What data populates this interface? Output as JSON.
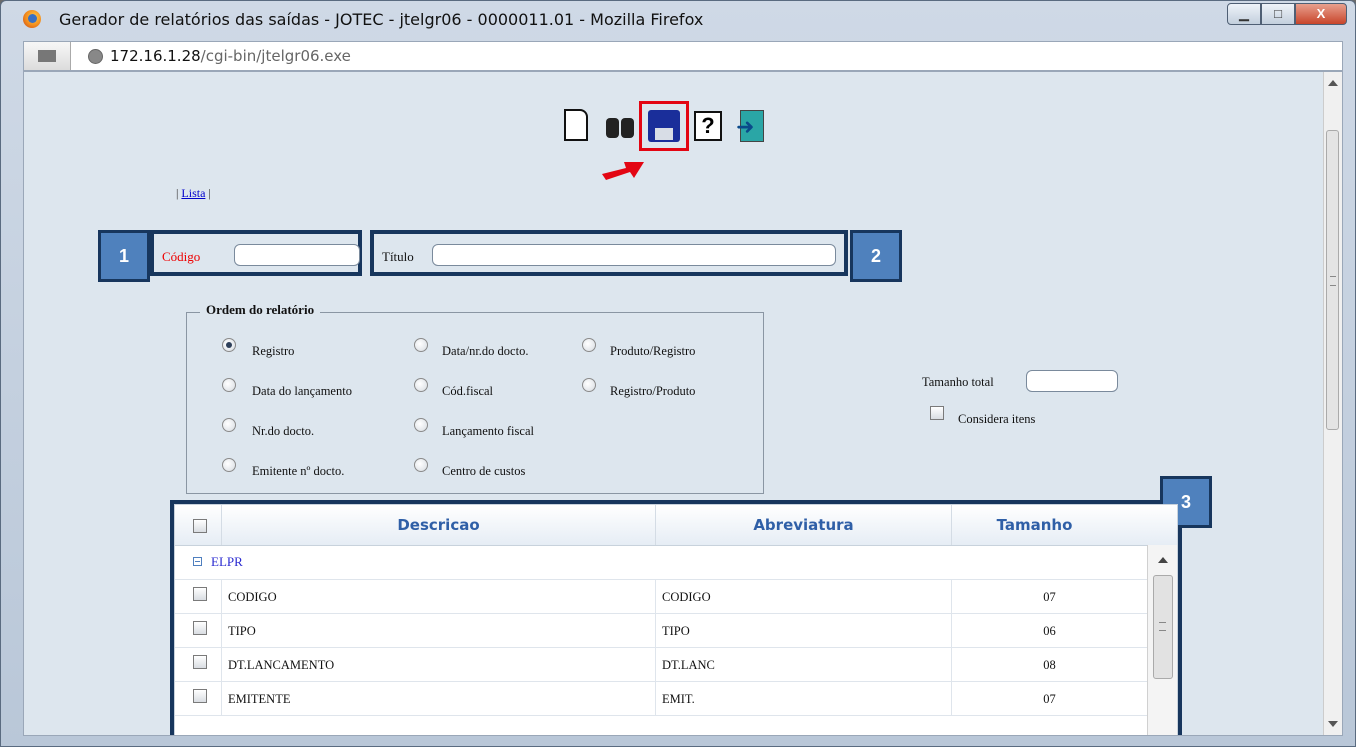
{
  "window": {
    "title": "Gerador de relatórios das saídas - JOTEC - jtelgr06 - 0000011.01 - Mozilla Firefox",
    "min_glyph": "▁",
    "max_glyph": "□",
    "close_glyph": "X"
  },
  "urlbar": {
    "host": "172.16.1.28",
    "path": "/cgi-bin/jtelgr06.exe"
  },
  "toolbar": {
    "icons": [
      "new-document",
      "binoculars-search",
      "save-floppy",
      "help",
      "exit"
    ],
    "highlight_color": "#e30613"
  },
  "nav": {
    "sep_left": "| ",
    "lista": "Lista",
    "sep_right": " |"
  },
  "form": {
    "codigo_label": "Código",
    "codigo_value": "",
    "titulo_label": "Título",
    "titulo_value": "",
    "tamanho_total_label": "Tamanho total",
    "tamanho_total_value": "",
    "considera_itens_label": "Considera itens"
  },
  "ordem": {
    "legend": "Ordem do relatório",
    "options": [
      {
        "label": "Registro",
        "checked": true
      },
      {
        "label": "Data do lançamento",
        "checked": false
      },
      {
        "label": "Nr.do docto.",
        "checked": false
      },
      {
        "label": "Emitente nº docto.",
        "checked": false
      },
      {
        "label": "Data/nr.do docto.",
        "checked": false
      },
      {
        "label": "Cód.fiscal",
        "checked": false
      },
      {
        "label": "Lançamento fiscal",
        "checked": false
      },
      {
        "label": "Centro de custos",
        "checked": false
      },
      {
        "label": "Produto/Registro",
        "checked": false
      },
      {
        "label": "Registro/Produto",
        "checked": false
      }
    ]
  },
  "grid": {
    "columns": [
      "Descricao",
      "Abreviatura",
      "Tamanho"
    ],
    "group": "ELPR",
    "rows": [
      {
        "descricao": "CODIGO",
        "abreviatura": "CODIGO",
        "tamanho": "07"
      },
      {
        "descricao": "TIPO",
        "abreviatura": "TIPO",
        "tamanho": "06"
      },
      {
        "descricao": "DT.LANCAMENTO",
        "abreviatura": "DT.LANC",
        "tamanho": "08"
      },
      {
        "descricao": "EMITENTE",
        "abreviatura": "EMIT.",
        "tamanho": "07"
      }
    ]
  },
  "callouts": {
    "one": "1",
    "two": "2",
    "three": "3",
    "badge_color": "#4f81bd",
    "border_color": "#17365d"
  },
  "arrow_color": "#e30613"
}
